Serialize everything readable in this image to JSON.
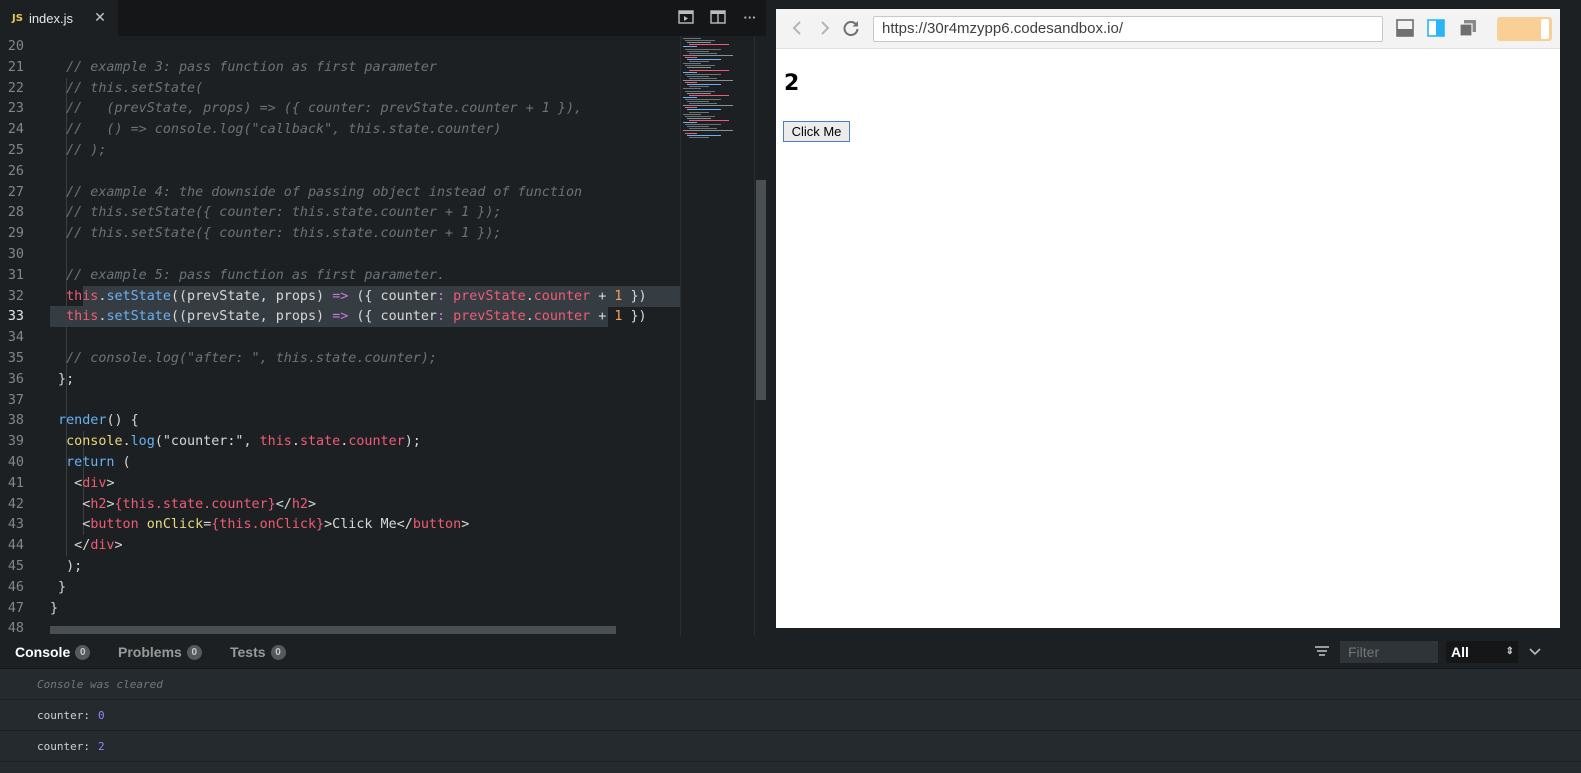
{
  "editor": {
    "tab": {
      "icon_label": "JS",
      "filename": "index.js"
    },
    "actions": {
      "run_icon": "play-preview-icon",
      "split_icon": "split-view-icon",
      "more_label": "···"
    },
    "lines": [
      {
        "num": "20",
        "tokens": []
      },
      {
        "num": "21",
        "tokens": [
          [
            "cm",
            "  // example 3: pass function as first parameter"
          ]
        ]
      },
      {
        "num": "22",
        "tokens": [
          [
            "cm",
            "  // this.setState("
          ]
        ]
      },
      {
        "num": "23",
        "tokens": [
          [
            "cm",
            "  //   (prevState, props) => ({ counter: prevState.counter + 1 }),"
          ]
        ]
      },
      {
        "num": "24",
        "tokens": [
          [
            "cm",
            "  //   () => console.log(\"callback\", this.state.counter)"
          ]
        ]
      },
      {
        "num": "25",
        "tokens": [
          [
            "cm",
            "  // );"
          ]
        ]
      },
      {
        "num": "26",
        "tokens": []
      },
      {
        "num": "27",
        "tokens": [
          [
            "cm",
            "  // example 4: the downside of passing object instead of function"
          ]
        ]
      },
      {
        "num": "28",
        "tokens": [
          [
            "cm",
            "  // this.setState({ counter: this.state.counter + 1 });"
          ]
        ]
      },
      {
        "num": "29",
        "tokens": [
          [
            "cm",
            "  // this.setState({ counter: this.state.counter + 1 });"
          ]
        ]
      },
      {
        "num": "30",
        "tokens": []
      },
      {
        "num": "31",
        "tokens": [
          [
            "cm",
            "  // example 5: pass function as first parameter."
          ]
        ]
      },
      {
        "num": "32",
        "tokens": [
          [
            "punc",
            "  "
          ],
          [
            "kw",
            "this"
          ],
          [
            "punc",
            "."
          ],
          [
            "fn",
            "setState"
          ],
          [
            "punc",
            "((prevState, props) "
          ],
          [
            "op",
            "=>"
          ],
          [
            "punc",
            " ({ counter"
          ],
          [
            "op",
            ":"
          ],
          [
            "punc",
            " "
          ],
          [
            "var",
            "prevState"
          ],
          [
            "punc",
            "."
          ],
          [
            "var",
            "counter"
          ],
          [
            "punc",
            " + "
          ],
          [
            "num",
            "1"
          ],
          [
            "punc",
            " })"
          ]
        ]
      },
      {
        "num": "33",
        "tokens": [
          [
            "punc",
            "  "
          ],
          [
            "kw",
            "this"
          ],
          [
            "punc",
            "."
          ],
          [
            "fn",
            "setState"
          ],
          [
            "punc",
            "((prevState, props) "
          ],
          [
            "op",
            "=>"
          ],
          [
            "punc",
            " ({ counter"
          ],
          [
            "op",
            ":"
          ],
          [
            "punc",
            " "
          ],
          [
            "var",
            "prevState"
          ],
          [
            "punc",
            "."
          ],
          [
            "var",
            "counter"
          ],
          [
            "punc",
            " + "
          ],
          [
            "num",
            "1"
          ],
          [
            "punc",
            " })"
          ]
        ]
      },
      {
        "num": "34",
        "tokens": []
      },
      {
        "num": "35",
        "tokens": [
          [
            "cm",
            "  // console.log(\"after: \", this.state.counter);"
          ]
        ]
      },
      {
        "num": "36",
        "tokens": [
          [
            "punc",
            " };"
          ]
        ]
      },
      {
        "num": "37",
        "tokens": []
      },
      {
        "num": "38",
        "tokens": [
          [
            "punc",
            " "
          ],
          [
            "fn",
            "render"
          ],
          [
            "punc",
            "() {"
          ]
        ]
      },
      {
        "num": "39",
        "tokens": [
          [
            "punc",
            "  "
          ],
          [
            "prop",
            "console"
          ],
          [
            "punc",
            "."
          ],
          [
            "fn",
            "log"
          ],
          [
            "punc",
            "(\"counter:\", "
          ],
          [
            "kw",
            "this"
          ],
          [
            "punc",
            "."
          ],
          [
            "var",
            "state"
          ],
          [
            "punc",
            "."
          ],
          [
            "var",
            "counter"
          ],
          [
            "punc",
            ");"
          ]
        ]
      },
      {
        "num": "40",
        "tokens": [
          [
            "punc",
            "  "
          ],
          [
            "fn",
            "return"
          ],
          [
            "punc",
            " ("
          ]
        ]
      },
      {
        "num": "41",
        "tokens": [
          [
            "punc",
            "   <"
          ],
          [
            "tag",
            "div"
          ],
          [
            "punc",
            ">"
          ]
        ]
      },
      {
        "num": "42",
        "tokens": [
          [
            "punc",
            "    <"
          ],
          [
            "tag",
            "h2"
          ],
          [
            "punc",
            ">"
          ],
          [
            "var",
            "{this.state.counter}"
          ],
          [
            "punc",
            "</"
          ],
          [
            "tag",
            "h2"
          ],
          [
            "punc",
            ">"
          ]
        ]
      },
      {
        "num": "43",
        "tokens": [
          [
            "punc",
            "    <"
          ],
          [
            "tag",
            "button"
          ],
          [
            "punc",
            " "
          ],
          [
            "prop",
            "onClick"
          ],
          [
            "punc",
            "="
          ],
          [
            "var",
            "{this.onClick}"
          ],
          [
            "punc",
            ">Click Me</"
          ],
          [
            "tag",
            "button"
          ],
          [
            "punc",
            ">"
          ]
        ]
      },
      {
        "num": "44",
        "tokens": [
          [
            "punc",
            "   </"
          ],
          [
            "tag",
            "div"
          ],
          [
            "punc",
            ">"
          ]
        ]
      },
      {
        "num": "45",
        "tokens": [
          [
            "punc",
            "  );"
          ]
        ]
      },
      {
        "num": "46",
        "tokens": [
          [
            "punc",
            " }"
          ]
        ]
      },
      {
        "num": "47",
        "tokens": [
          [
            "punc",
            "}"
          ]
        ]
      },
      {
        "num": "48",
        "tokens": []
      }
    ],
    "active_line": "33",
    "highlighted_lines": [
      "32",
      "33"
    ]
  },
  "browser": {
    "back_icon": "chevron-left-icon",
    "forward_icon": "chevron-right-icon",
    "reload_icon": "reload-icon",
    "url": "https://30r4mzypp6.codesandbox.io/",
    "counter_value": "2",
    "button_label": "Click Me",
    "toggle_color": "#f9cf95"
  },
  "console": {
    "tabs": [
      {
        "label": "Console",
        "count": "0",
        "active": true
      },
      {
        "label": "Problems",
        "count": "0",
        "active": false
      },
      {
        "label": "Tests",
        "count": "0",
        "active": false
      }
    ],
    "filter_placeholder": "Filter",
    "level": "All",
    "entries": [
      {
        "text": "Console was cleared",
        "value": "",
        "type": "cleared"
      },
      {
        "text": "counter:",
        "value": "0",
        "type": "log"
      },
      {
        "text": "counter:",
        "value": "2",
        "type": "log"
      }
    ]
  }
}
